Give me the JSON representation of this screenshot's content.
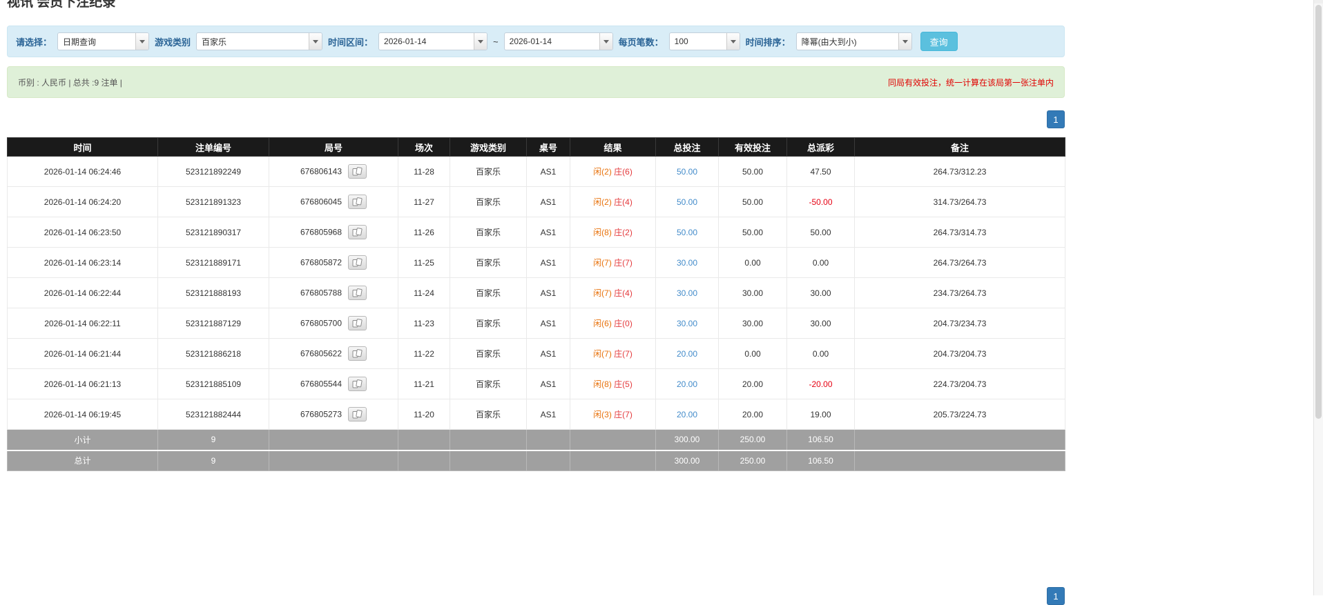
{
  "page": {
    "title": "视讯 会员下注纪录"
  },
  "colors": {
    "accent_blue": "#337ab7",
    "filter_bar_bg": "#d9edf7",
    "summary_bar_bg": "#dff0d8",
    "table_header_bg": "#1a1a1a",
    "table_footer_bg": "#a0a0a0",
    "link_blue": "#428bca",
    "negative_red": "#e60012",
    "player_color": "#e8710a",
    "banker_color": "#e4393c",
    "query_button_bg": "#5bc0de"
  },
  "icons": {
    "scroll_up_arrow": "▲",
    "combo_arrow": "chevron-down",
    "view_cards": "cards-icon"
  },
  "filters": {
    "select_label": "请选择：",
    "select_value": "日期查询",
    "game_category_label": "游戏类别",
    "game_category_value": "百家乐",
    "time_range_label": "时间区间：",
    "date_from": "2026-01-14",
    "date_separator": "~",
    "date_to": "2026-01-14",
    "page_size_label": "每页笔数：",
    "page_size_value": "100",
    "sort_label": "时间排序：",
    "sort_value": "降幂(由大到小)",
    "query_button": "查询"
  },
  "summary": {
    "left": "币别 : 人民币 | 总共 :9 注单 |",
    "right": "同局有效投注，统一计算在该局第一张注单内"
  },
  "pagination": {
    "page": "1"
  },
  "table": {
    "headers": [
      "时间",
      "注单编号",
      "局号",
      "场次",
      "游戏类别",
      "桌号",
      "结果",
      "总投注",
      "有效投注",
      "总派彩",
      "备注"
    ],
    "rows": [
      {
        "time": "2026-01-14 06:24:46",
        "bet_id": "523121892249",
        "game_no": "676806143",
        "session": "11-28",
        "category": "百家乐",
        "table_no": "AS1",
        "result_player": "闲(2)",
        "result_banker": "庄(6)",
        "total_bet": "50.00",
        "valid_bet": "50.00",
        "payout": "47.50",
        "remark": "264.73/312.23"
      },
      {
        "time": "2026-01-14 06:24:20",
        "bet_id": "523121891323",
        "game_no": "676806045",
        "session": "11-27",
        "category": "百家乐",
        "table_no": "AS1",
        "result_player": "闲(2)",
        "result_banker": "庄(4)",
        "total_bet": "50.00",
        "valid_bet": "50.00",
        "payout": "-50.00",
        "remark": "314.73/264.73"
      },
      {
        "time": "2026-01-14 06:23:50",
        "bet_id": "523121890317",
        "game_no": "676805968",
        "session": "11-26",
        "category": "百家乐",
        "table_no": "AS1",
        "result_player": "闲(8)",
        "result_banker": "庄(2)",
        "total_bet": "50.00",
        "valid_bet": "50.00",
        "payout": "50.00",
        "remark": "264.73/314.73"
      },
      {
        "time": "2026-01-14 06:23:14",
        "bet_id": "523121889171",
        "game_no": "676805872",
        "session": "11-25",
        "category": "百家乐",
        "table_no": "AS1",
        "result_player": "闲(7)",
        "result_banker": "庄(7)",
        "total_bet": "30.00",
        "valid_bet": "0.00",
        "payout": "0.00",
        "remark": "264.73/264.73"
      },
      {
        "time": "2026-01-14 06:22:44",
        "bet_id": "523121888193",
        "game_no": "676805788",
        "session": "11-24",
        "category": "百家乐",
        "table_no": "AS1",
        "result_player": "闲(7)",
        "result_banker": "庄(4)",
        "total_bet": "30.00",
        "valid_bet": "30.00",
        "payout": "30.00",
        "remark": "234.73/264.73"
      },
      {
        "time": "2026-01-14 06:22:11",
        "bet_id": "523121887129",
        "game_no": "676805700",
        "session": "11-23",
        "category": "百家乐",
        "table_no": "AS1",
        "result_player": "闲(6)",
        "result_banker": "庄(0)",
        "total_bet": "30.00",
        "valid_bet": "30.00",
        "payout": "30.00",
        "remark": "204.73/234.73"
      },
      {
        "time": "2026-01-14 06:21:44",
        "bet_id": "523121886218",
        "game_no": "676805622",
        "session": "11-22",
        "category": "百家乐",
        "table_no": "AS1",
        "result_player": "闲(7)",
        "result_banker": "庄(7)",
        "total_bet": "20.00",
        "valid_bet": "0.00",
        "payout": "0.00",
        "remark": "204.73/204.73"
      },
      {
        "time": "2026-01-14 06:21:13",
        "bet_id": "523121885109",
        "game_no": "676805544",
        "session": "11-21",
        "category": "百家乐",
        "table_no": "AS1",
        "result_player": "闲(8)",
        "result_banker": "庄(5)",
        "total_bet": "20.00",
        "valid_bet": "20.00",
        "payout": "-20.00",
        "remark": "224.73/204.73"
      },
      {
        "time": "2026-01-14 06:19:45",
        "bet_id": "523121882444",
        "game_no": "676805273",
        "session": "11-20",
        "category": "百家乐",
        "table_no": "AS1",
        "result_player": "闲(3)",
        "result_banker": "庄(7)",
        "total_bet": "20.00",
        "valid_bet": "20.00",
        "payout": "19.00",
        "remark": "205.73/224.73"
      }
    ],
    "subtotal": {
      "label": "小计",
      "count": "9",
      "total_bet": "300.00",
      "valid_bet": "250.00",
      "payout": "106.50"
    },
    "total": {
      "label": "总计",
      "count": "9",
      "total_bet": "300.00",
      "valid_bet": "250.00",
      "payout": "106.50"
    }
  }
}
